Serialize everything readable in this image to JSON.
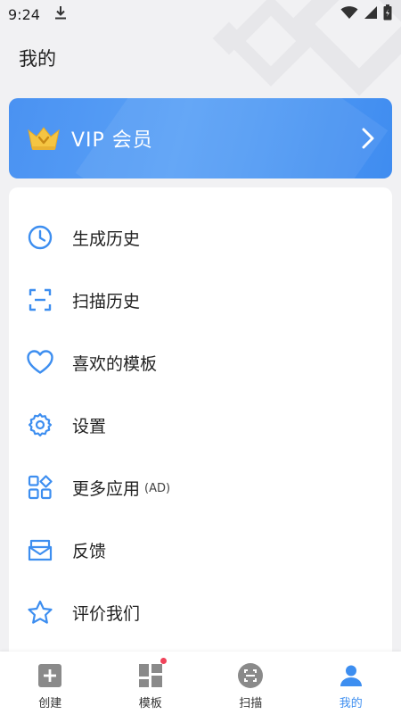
{
  "status_bar": {
    "time": "9:24"
  },
  "page": {
    "title": "我的"
  },
  "vip": {
    "label": "VIP 会员"
  },
  "menu": [
    {
      "label": "生成历史",
      "icon": "clock-icon"
    },
    {
      "label": "扫描历史",
      "icon": "scan-frame-icon"
    },
    {
      "label": "喜欢的模板",
      "icon": "heart-icon"
    },
    {
      "label": "设置",
      "icon": "gear-icon"
    },
    {
      "label": "更多应用",
      "tag": "(AD)",
      "icon": "apps-grid-icon"
    },
    {
      "label": "反馈",
      "icon": "mail-icon"
    },
    {
      "label": "评价我们",
      "icon": "star-icon"
    }
  ],
  "tabs": [
    {
      "label": "创建",
      "icon": "plus-square-icon",
      "active": false
    },
    {
      "label": "模板",
      "icon": "template-grid-icon",
      "active": false,
      "badge": true
    },
    {
      "label": "扫描",
      "icon": "scan-circle-icon",
      "active": false
    },
    {
      "label": "我的",
      "icon": "person-icon",
      "active": true
    }
  ],
  "colors": {
    "accent": "#3d8ef0",
    "vip_gradient_start": "#4a92f2",
    "badge": "#f0435a",
    "crown": "#f5c542"
  }
}
